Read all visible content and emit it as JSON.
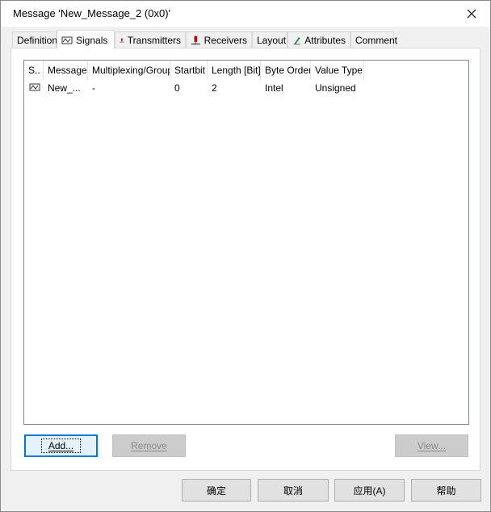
{
  "window": {
    "title": "Message 'New_Message_2 (0x0)'",
    "close_glyph": "✕"
  },
  "tabs": [
    {
      "label": "Definition",
      "icon": "",
      "active": false
    },
    {
      "label": "Signals",
      "icon": "signal-icon",
      "active": true
    },
    {
      "label": "Transmitters",
      "icon": "transmitter-icon",
      "active": false
    },
    {
      "label": "Receivers",
      "icon": "receiver-icon",
      "active": false
    },
    {
      "label": "Layout",
      "icon": "",
      "active": false
    },
    {
      "label": "Attributes",
      "icon": "attribute-icon",
      "active": false
    },
    {
      "label": "Comment",
      "icon": "",
      "active": false
    }
  ],
  "signals_list": {
    "columns": [
      "S..",
      "Message",
      "Multiplexing/Group",
      "Startbit",
      "Length [Bit]",
      "Byte Order",
      "Value Type"
    ],
    "rows": [
      {
        "icon": "signal-icon",
        "message": "New_...",
        "multiplexing": "-",
        "startbit": "0",
        "length": "2",
        "byte_order": "Intel",
        "value_type": "Unsigned"
      }
    ]
  },
  "panel_buttons": {
    "add": "Add...",
    "remove": "Remove",
    "view": "View..."
  },
  "dialog_buttons": {
    "ok": "确定",
    "cancel": "取消",
    "apply": "应用(A)",
    "help": "帮助"
  },
  "colors": {
    "focus_accent": "#0078d7",
    "icon_red": "#cc0000",
    "icon_green": "#2e8b57"
  }
}
